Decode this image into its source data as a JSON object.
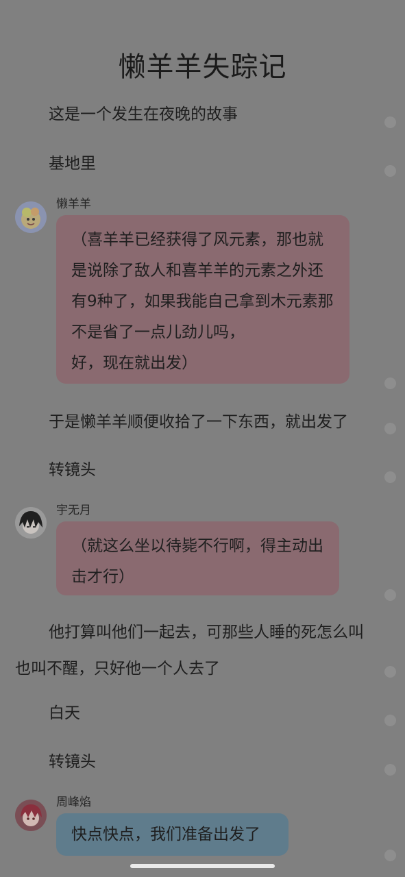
{
  "story": {
    "title": "懒羊羊失踪记"
  },
  "lines": [
    {
      "kind": "narration",
      "text": "这是一个发生在夜晚的故事"
    },
    {
      "kind": "narration",
      "text": "基地里"
    },
    {
      "kind": "dialog",
      "speaker": "懒羊羊",
      "avatar": "lazy-sheep-avatar",
      "bubble_color": "#8a6a70",
      "text": "（喜羊羊已经获得了风元素，那也就是说除了敌人和喜羊羊的元素之外还有9种了，如果我能自己拿到木元素那不是省了一点儿劲儿吗，\n好，现在就出发）"
    },
    {
      "kind": "narration",
      "text": "于是懒羊羊顺便收拾了一下东西，就出发了"
    },
    {
      "kind": "narration",
      "text": "转镜头"
    },
    {
      "kind": "dialog",
      "speaker": "宇无月",
      "avatar": "yu-wuyue-avatar",
      "bubble_color": "#8a6a70",
      "text": "（就这么坐以待毙不行啊，得主动出击才行）"
    },
    {
      "kind": "narration",
      "text": "他打算叫他们一起去，可那些人睡的死怎么叫也叫不醒，只好他一个人去了"
    },
    {
      "kind": "narration",
      "text": "白天"
    },
    {
      "kind": "narration",
      "text": "转镜头"
    },
    {
      "kind": "dialog",
      "speaker": "周峰焰",
      "avatar": "zhou-fengyan-avatar",
      "bubble_color": "#5f7c8c",
      "text": "快点快点，我们准备出发了"
    }
  ]
}
